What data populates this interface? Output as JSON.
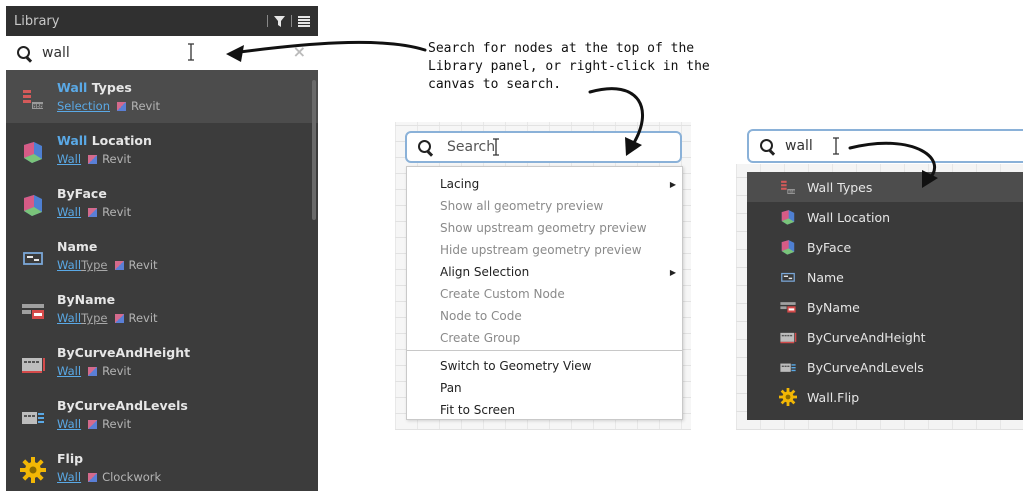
{
  "library": {
    "title": "Library",
    "search_value": "wall",
    "clear_label": "×",
    "results": [
      {
        "name_hl": "Wall",
        "name_rest": " Types",
        "cat_hl": "Selection",
        "cat_rest": "",
        "pkg": "Revit",
        "icon": "wall-types-icon"
      },
      {
        "name_hl": "Wall",
        "name_rest": " Location",
        "cat_hl": "Wall",
        "cat_rest": "",
        "pkg": "Revit",
        "icon": "wall-location-icon"
      },
      {
        "name_hl": "",
        "name_rest": "ByFace",
        "cat_hl": "Wall",
        "cat_rest": "",
        "pkg": "Revit",
        "icon": "byface-icon"
      },
      {
        "name_hl": "",
        "name_rest": "Name",
        "cat_hl": "Wall",
        "cat_rest": "Type",
        "pkg": "Revit",
        "icon": "name-icon"
      },
      {
        "name_hl": "",
        "name_rest": "ByName",
        "cat_hl": "Wall",
        "cat_rest": "Type",
        "pkg": "Revit",
        "icon": "byname-icon"
      },
      {
        "name_hl": "",
        "name_rest": "ByCurveAndHeight",
        "cat_hl": "Wall",
        "cat_rest": "",
        "pkg": "Revit",
        "icon": "bycurveandheight-icon"
      },
      {
        "name_hl": "",
        "name_rest": "ByCurveAndLevels",
        "cat_hl": "Wall",
        "cat_rest": "",
        "pkg": "Revit",
        "icon": "bycurveandlevels-icon"
      },
      {
        "name_hl": "",
        "name_rest": "Flip",
        "cat_hl": "Wall",
        "cat_rest": "",
        "pkg": "Clockwork",
        "icon": "flip-gear-icon"
      }
    ]
  },
  "annotation": {
    "lines": [
      "Search for nodes at the top of the",
      "Library panel, or right-click in the",
      "canvas to search."
    ]
  },
  "canvas_search": {
    "placeholder": "Search",
    "menu": [
      {
        "label": "Lacing",
        "enabled": true,
        "submenu": true
      },
      {
        "label": "Show all geometry preview",
        "enabled": false
      },
      {
        "label": "Show upstream geometry preview",
        "enabled": false
      },
      {
        "label": "Hide upstream geometry preview",
        "enabled": false
      },
      {
        "label": "Align Selection",
        "enabled": true,
        "submenu": true
      },
      {
        "label": "Create Custom Node",
        "enabled": false
      },
      {
        "label": "Node to Code",
        "enabled": false
      },
      {
        "label": "Create Group",
        "enabled": false
      },
      {
        "label": "Switch to Geometry View",
        "enabled": true
      },
      {
        "label": "Pan",
        "enabled": true
      },
      {
        "label": "Fit to Screen",
        "enabled": true
      }
    ]
  },
  "canvas_results": {
    "search_value": "wall",
    "items": [
      {
        "label": "Wall Types",
        "icon": "wall-types-icon"
      },
      {
        "label": "Wall Location",
        "icon": "wall-location-icon"
      },
      {
        "label": "ByFace",
        "icon": "byface-icon"
      },
      {
        "label": "Name",
        "icon": "name-icon"
      },
      {
        "label": "ByName",
        "icon": "byname-icon"
      },
      {
        "label": "ByCurveAndHeight",
        "icon": "bycurveandheight-icon"
      },
      {
        "label": "ByCurveAndLevels",
        "icon": "bycurveandlevels-icon"
      },
      {
        "label": "Wall.Flip",
        "icon": "flip-gear-icon"
      }
    ]
  },
  "colors": {
    "highlight": "#5aa9e6",
    "panel": "#3c3c3c",
    "header": "#303030",
    "search_border": "#8ab1d8"
  }
}
